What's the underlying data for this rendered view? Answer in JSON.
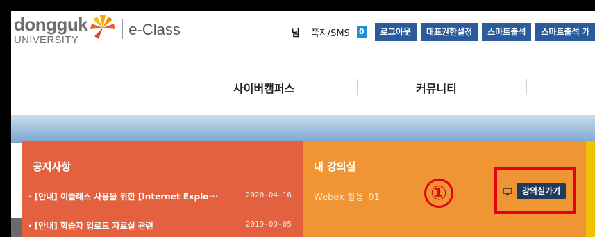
{
  "header": {
    "logo_main": "dongguk",
    "logo_sub": "UNIVERSITY",
    "logo_eclass": "e-Class",
    "user_suffix": "님",
    "msg_label": "쪽지/SMS",
    "msg_count": "0",
    "buttons": [
      "로그아웃",
      "대표권한설정",
      "스마트출석",
      "스마트출석 가"
    ]
  },
  "nav": {
    "items": [
      "사이버캠퍼스",
      "커뮤니티"
    ]
  },
  "notice": {
    "title": "공지사항",
    "items": [
      {
        "text": "· [안내] 이클래스 사용을 위한 [Internet Explo···",
        "date": "2020-04-16"
      },
      {
        "text": "· [안내] 학습자 업로드 자료실 관련",
        "date": "2019-09-05"
      }
    ]
  },
  "lecture": {
    "title": "내 강의실",
    "course": "Webex 활용_01",
    "step_marker": "①",
    "enter_label": "강의실가기"
  },
  "colors": {
    "notice_bg": "#e3613f",
    "lecture_bg": "#ef9534",
    "button_blue": "#2c5b9b",
    "highlight_red": "#e60012"
  }
}
